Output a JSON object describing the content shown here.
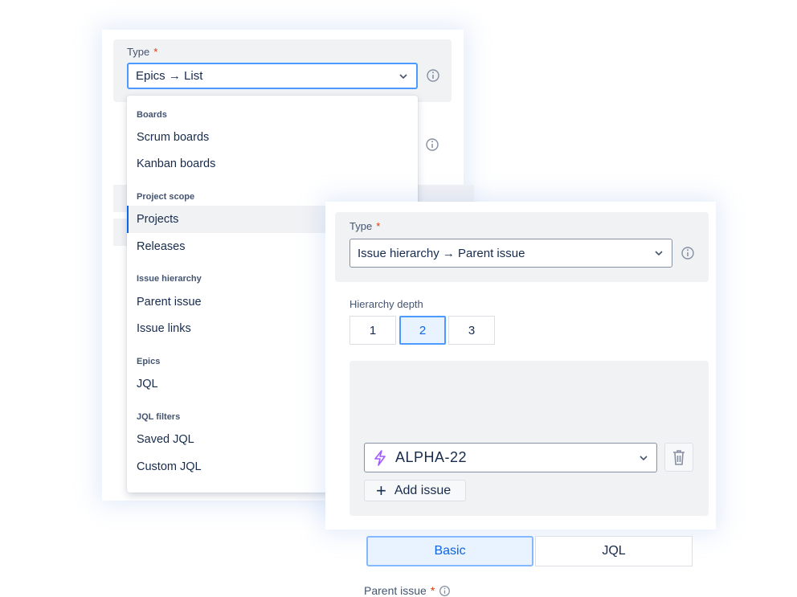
{
  "card_a": {
    "type_label": "Type",
    "required_mark": "*",
    "type_value": "Epics → List",
    "menu": {
      "groups": [
        {
          "header": "Boards",
          "items": [
            "Scrum boards",
            "Kanban boards"
          ]
        },
        {
          "header": "Project scope",
          "items": [
            "Projects",
            "Releases"
          ]
        },
        {
          "header": "Issue hierarchy",
          "items": [
            "Parent issue",
            "Issue links"
          ]
        },
        {
          "header": "Epics",
          "items": [
            "JQL"
          ]
        },
        {
          "header": "JQL filters",
          "items": [
            "Saved JQL",
            "Custom JQL"
          ]
        }
      ],
      "selected_item": "Projects"
    }
  },
  "card_b": {
    "type_label": "Type",
    "required_mark": "*",
    "type_value": "Issue hierarchy → Parent issue",
    "depth_label": "Hierarchy depth",
    "depth_options": [
      "1",
      "2",
      "3"
    ],
    "depth_selected": "2",
    "modes": [
      "Basic",
      "JQL"
    ],
    "mode_selected": "Basic",
    "parent_label": "Parent issue",
    "parent_required": "*",
    "parent_value": "ALPHA-22",
    "add_label": "Add issue",
    "add_icon": "+"
  },
  "colors": {
    "accent": "#0c66e4",
    "focus_border": "#4c9aff",
    "selected_bg": "#e9f2ff",
    "required": "#de350b",
    "panel_bg": "#f1f2f4",
    "epic_icon": "#a259ff"
  }
}
